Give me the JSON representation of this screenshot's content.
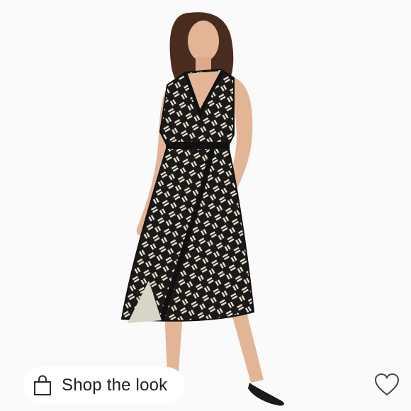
{
  "product_image": {
    "alt_icon": "dress-photo",
    "colors": {
      "dress_dark": "#1c1a18",
      "dress_light": "#e8e0d2",
      "background": "#fafafa",
      "skin": "#e2b597",
      "hair": "#4a2c1e"
    }
  },
  "shop_button": {
    "label": "Shop the look",
    "icon": "shopping-bag-icon"
  },
  "favorite_button": {
    "icon": "heart-icon"
  }
}
